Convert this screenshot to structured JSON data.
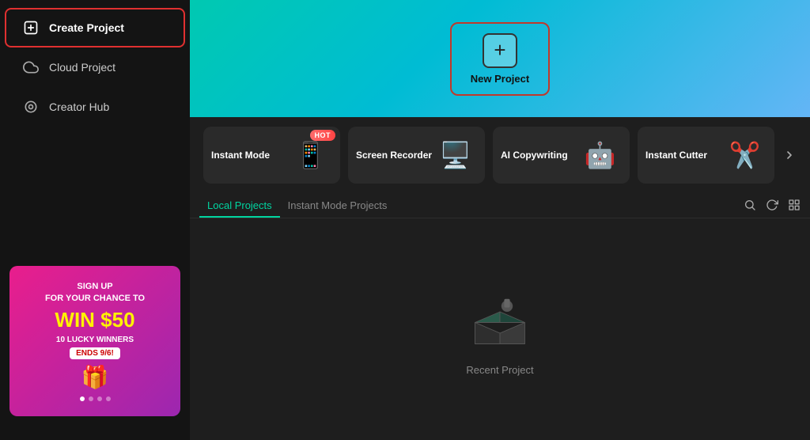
{
  "sidebar": {
    "items": [
      {
        "id": "create-project",
        "label": "Create Project",
        "active": true
      },
      {
        "id": "cloud-project",
        "label": "Cloud Project",
        "active": false
      },
      {
        "id": "creator-hub",
        "label": "Creator Hub",
        "active": false
      }
    ]
  },
  "promo": {
    "line1": "SIGN UP",
    "line2": "FOR YOUR CHANCE TO",
    "amount": "WIN $50",
    "sub": "10 LUCKY WINNERS",
    "badge": "ENDS 9/6!",
    "icon": "🎁"
  },
  "hero": {
    "new_project_label": "New Project"
  },
  "tools": [
    {
      "id": "instant-mode",
      "label": "Instant Mode",
      "hot": true,
      "emoji": "📱"
    },
    {
      "id": "screen-recorder",
      "label": "Screen Recorder",
      "hot": false,
      "emoji": "🖥️"
    },
    {
      "id": "ai-copywriting",
      "label": "AI Copywriting",
      "hot": false,
      "emoji": "🤖"
    },
    {
      "id": "instant-cutter",
      "label": "Instant Cutter",
      "hot": false,
      "emoji": "✂️"
    }
  ],
  "tools_chevron": ">",
  "tabs": [
    {
      "id": "local-projects",
      "label": "Local Projects",
      "active": true
    },
    {
      "id": "instant-mode-projects",
      "label": "Instant Mode Projects",
      "active": false
    }
  ],
  "projects_empty": {
    "label": "Recent Project"
  },
  "dots": [
    true,
    false,
    false,
    false
  ]
}
